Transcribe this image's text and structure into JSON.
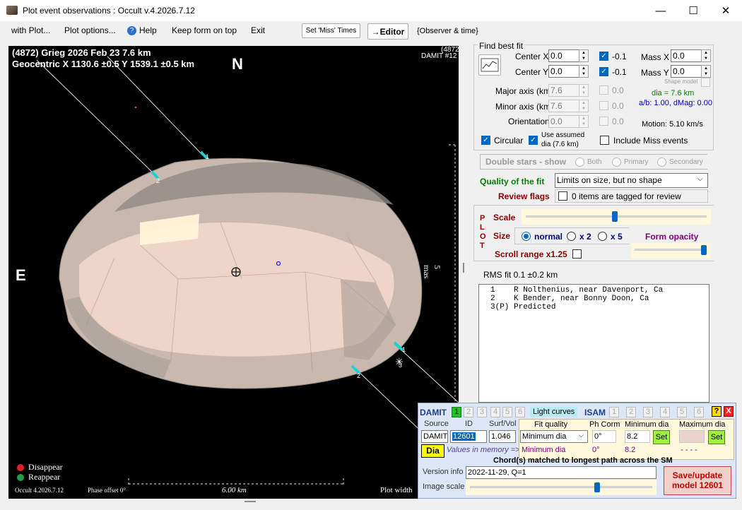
{
  "window": {
    "title": "Plot event observations : Occult v.4.2026.7.12"
  },
  "controls": {
    "minimize": "—",
    "maximize": "☐",
    "close": "✕"
  },
  "menu": {
    "with_plot": "with Plot...",
    "plot_options": "Plot options...",
    "help": "Help",
    "keep_on_top": "Keep form on top",
    "exit": "Exit",
    "set_miss_times": "Set 'Miss' Times",
    "editor": "→Editor",
    "observer_time": "{Observer & time}"
  },
  "plot": {
    "header1": "(4872) Grieg  2026 Feb 23   7.6 km",
    "header2": "Geocentric  X  1130.6 ±0.5  Y 1539.1 ±0.5 km",
    "north": "N",
    "east": "E",
    "damit_tag1": "(4872",
    "damit_tag2": "DAMIT #12",
    "scale_side": "5 mas",
    "scale_bottom": "6.00 km",
    "legend_disappear": "Disappear",
    "legend_reappear": "Reappear",
    "version": "Occult 4.2026.7.12",
    "phase_offset": "Phase offset 0°",
    "plot_width": "Plot width",
    "chord_labels": [
      "1",
      "2",
      "1",
      "2",
      "3"
    ],
    "colors": {
      "disappear": "#e02020",
      "reappear": "#20a040",
      "chord_marker": "#20d0d0"
    }
  },
  "fit": {
    "group_title": "Find best fit",
    "center_x_label": "Center X",
    "center_x": "0.0",
    "center_y_label": "Center Y",
    "center_y": "0.0",
    "cx_step": "-0.1",
    "cy_step": "-0.1",
    "mass_x_label": "Mass X",
    "mass_x": "0.0",
    "mass_y_label": "Mass Y",
    "mass_y": "0.0",
    "shape_model": "Shape model",
    "major_label": "Major axis (km)",
    "major": "7.6",
    "minor_label": "Minor axis (km)",
    "minor": "7.6",
    "orient_label": "Orientation",
    "orient": "0.0",
    "step_zero": "0.0",
    "dia_text": "dia = 7.6 km",
    "ab_text": "a/b: 1.00, dMag: 0.00",
    "motion_text": "Motion: 5.10 km/s",
    "circular": "Circular",
    "use_assumed_1": "Use assumed",
    "use_assumed_2": "dia (7.6 km)",
    "include_miss": "Include Miss events",
    "double_stars": "Double stars - show",
    "both": "Both",
    "primary": "Primary",
    "secondary": "Secondary",
    "quality_label": "Quality of the fit",
    "quality_value": "Limits on size, but no shape",
    "review_label": "Review flags",
    "review_text": "0 items are tagged for review"
  },
  "plotbox": {
    "plot_letters": [
      "P",
      "L",
      "O",
      "T"
    ],
    "scale": "Scale",
    "size": "Size",
    "normal": "normal",
    "x2": "x 2",
    "x5": "x 5",
    "form_opacity": "Form opacity",
    "scroll_range": "Scroll range x1.25"
  },
  "rms": "RMS fit 0.1 ±0.2 km",
  "observers": [
    "1    R Nolthenius, near Davenport, Ca",
    "2    K Bender, near Bonny Doon, Ca",
    "3(P) Predicted"
  ],
  "damit": {
    "damit_label": "DAMIT",
    "tabs": [
      "1",
      "2",
      "3",
      "4",
      "5",
      "6"
    ],
    "light_curves": "Light curves",
    "isam_label": "ISAM",
    "isam_tabs": [
      "1",
      "2",
      "3",
      "4",
      "5",
      "6"
    ],
    "help": "?",
    "close": "X",
    "source_label": "Source",
    "id_label": "ID",
    "surfvol_label": "Surf/Vol",
    "source": "DAMIT",
    "id": "12601",
    "surfvol": "1.046",
    "dia_button": "Dia",
    "values_mem": "Values in memory =>",
    "fit_quality_label": "Fit quality",
    "ph_corr_label": "Ph Corm",
    "min_dia_label": "Minimum dia",
    "max_dia_label": "Maximum dia",
    "fit_quality": "Minimum dia",
    "ph_corr": "0°",
    "min_dia": "8.2",
    "set": "Set",
    "mem_fit": "Minimum dia",
    "mem_ph": "0°",
    "mem_min": "8.2",
    "mem_max": "- - - -",
    "chord_msg": "Chord(s) matched to longest path across the SM",
    "version_label": "Version info",
    "version": "2022-11-29, Q=1",
    "image_scale_label": "Image scale",
    "save_1": "Save/update",
    "save_2": "model 12601"
  }
}
